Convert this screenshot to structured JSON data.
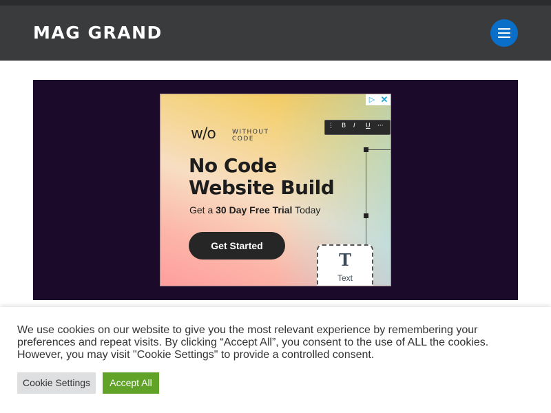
{
  "header": {
    "site_title": "MAG GRAND",
    "menu_icon": "hamburger-icon"
  },
  "ad": {
    "brand_logo": "w/o",
    "brand_name": "WITHOUT CODE",
    "headline": "No Code Website Build",
    "sub_prefix": "Get a ",
    "sub_bold": "30 Day Free Trial",
    "sub_suffix": " Today",
    "cta_label": "Get Started",
    "toolbar": [
      "⋮",
      "B",
      "I",
      "U",
      "···"
    ],
    "text_widget_glyph": "T",
    "text_widget_label": "Text",
    "choices_icon": "▷",
    "close_icon": "✕"
  },
  "cookie": {
    "message": "We use cookies on our website to give you the most relevant experience by remembering your preferences and repeat visits. By clicking “Accept All”, you consent to the use of ALL the cookies. However, you may visit \"Cookie Settings\" to provide a controlled consent.",
    "settings_label": "Cookie Settings",
    "accept_label": "Accept All"
  },
  "colors": {
    "header_bg": "#3a3b3d",
    "menu_button": "#0a6fc9",
    "ad_bg": "#1c0a2a",
    "accept_button": "#61a229"
  }
}
